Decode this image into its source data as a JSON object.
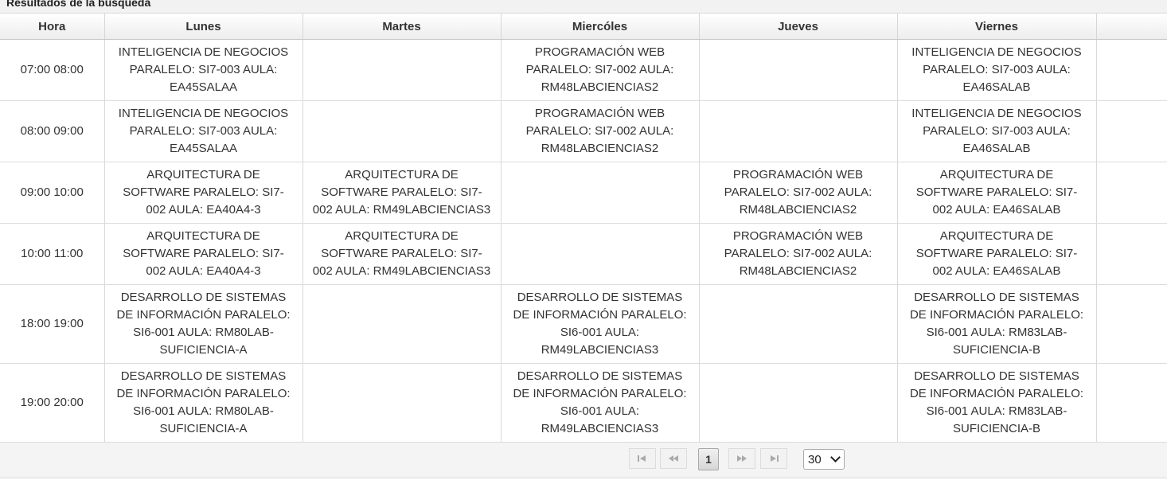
{
  "panel": {
    "title": "Resultados de la búsqueda"
  },
  "columns": [
    "Hora",
    "Lunes",
    "Martes",
    "Miercóles",
    "Jueves",
    "Viernes",
    ""
  ],
  "rows": [
    {
      "hora": "07:00 08:00",
      "cells": [
        "INTELIGENCIA DE NEGOCIOS PARALELO: SI7-003 AULA: EA45SALAA",
        "",
        "PROGRAMACIÓN WEB PARALELO: SI7-002 AULA: RM48LABCIENCIAS2",
        "",
        "INTELIGENCIA DE NEGOCIOS PARALELO: SI7-003 AULA: EA46SALAB"
      ]
    },
    {
      "hora": "08:00 09:00",
      "cells": [
        "INTELIGENCIA DE NEGOCIOS PARALELO: SI7-003 AULA: EA45SALAA",
        "",
        "PROGRAMACIÓN WEB PARALELO: SI7-002 AULA: RM48LABCIENCIAS2",
        "",
        "INTELIGENCIA DE NEGOCIOS PARALELO: SI7-003 AULA: EA46SALAB"
      ]
    },
    {
      "hora": "09:00 10:00",
      "cells": [
        "ARQUITECTURA DE SOFTWARE PARALELO: SI7-002 AULA: EA40A4-3",
        "ARQUITECTURA DE SOFTWARE PARALELO: SI7-002 AULA: RM49LABCIENCIAS3",
        "",
        "PROGRAMACIÓN WEB PARALELO: SI7-002 AULA: RM48LABCIENCIAS2",
        "ARQUITECTURA DE SOFTWARE PARALELO: SI7-002 AULA: EA46SALAB"
      ]
    },
    {
      "hora": "10:00 11:00",
      "cells": [
        "ARQUITECTURA DE SOFTWARE PARALELO: SI7-002 AULA: EA40A4-3",
        "ARQUITECTURA DE SOFTWARE PARALELO: SI7-002 AULA: RM49LABCIENCIAS3",
        "",
        "PROGRAMACIÓN WEB PARALELO: SI7-002 AULA: RM48LABCIENCIAS2",
        "ARQUITECTURA DE SOFTWARE PARALELO: SI7-002 AULA: EA46SALAB"
      ]
    },
    {
      "hora": "18:00 19:00",
      "cells": [
        "DESARROLLO DE SISTEMAS DE INFORMACIÓN PARALELO: SI6-001 AULA: RM80LAB-SUFICIENCIA-A",
        "",
        "DESARROLLO DE SISTEMAS DE INFORMACIÓN PARALELO: SI6-001 AULA: RM49LABCIENCIAS3",
        "",
        "DESARROLLO DE SISTEMAS DE INFORMACIÓN PARALELO: SI6-001 AULA: RM83LAB-SUFICIENCIA-B"
      ]
    },
    {
      "hora": "19:00 20:00",
      "cells": [
        "DESARROLLO DE SISTEMAS DE INFORMACIÓN PARALELO: SI6-001 AULA: RM80LAB-SUFICIENCIA-A",
        "",
        "DESARROLLO DE SISTEMAS DE INFORMACIÓN PARALELO: SI6-001 AULA: RM49LABCIENCIAS3",
        "",
        "DESARROLLO DE SISTEMAS DE INFORMACIÓN PARALELO: SI6-001 AULA: RM83LAB-SUFICIENCIA-B"
      ]
    }
  ],
  "paginator": {
    "first_icon": "first-page-icon",
    "prev_icon": "prev-page-icon",
    "next_icon": "next-page-icon",
    "last_icon": "last-page-icon",
    "current_page": "1",
    "rows_per_page": "30"
  }
}
